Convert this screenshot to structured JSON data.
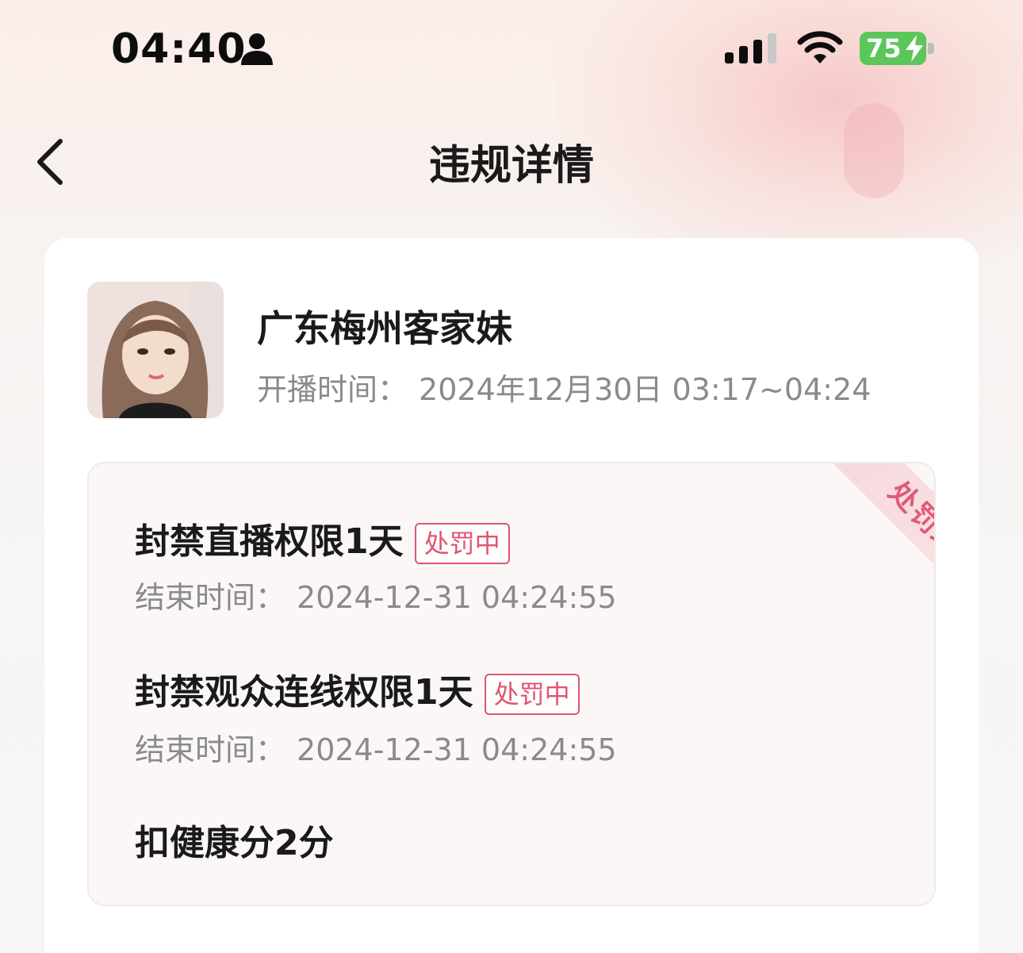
{
  "status_bar": {
    "time": "04:40",
    "battery": "75"
  },
  "nav": {
    "title": "违规详情"
  },
  "streamer": {
    "name": "广东梅州客家妹",
    "live_time_label": "开播时间：",
    "live_time_value": "2024年12月30日 03:17~04:24"
  },
  "penalty": {
    "ribbon_label": "处罚结果",
    "items": [
      {
        "title": "封禁直播权限1天",
        "badge": "处罚中",
        "end_label": "结束时间：",
        "end_value": "2024-12-31 04:24:55"
      },
      {
        "title": "封禁观众连线权限1天",
        "badge": "处罚中",
        "end_label": "结束时间：",
        "end_value": "2024-12-31 04:24:55"
      },
      {
        "title": "扣健康分2分"
      }
    ]
  },
  "colors": {
    "accent_red": "#e0556e",
    "battery_green": "#5cc65a",
    "muted_text": "#8a8a8a"
  }
}
